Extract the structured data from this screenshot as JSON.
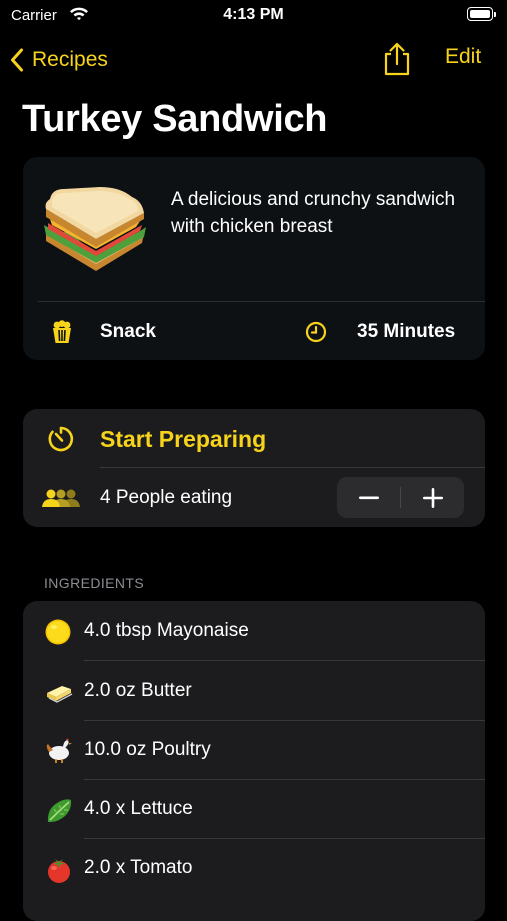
{
  "status_bar": {
    "carrier": "Carrier",
    "time": "4:13 PM"
  },
  "nav": {
    "back_label": "Recipes",
    "edit_label": "Edit"
  },
  "recipe": {
    "title": "Turkey Sandwich",
    "description": "A delicious and crunchy sandwich with chicken breast",
    "category": "Snack",
    "duration": "35 Minutes"
  },
  "preparation": {
    "start_label": "Start Preparing",
    "people_label": "4 People eating"
  },
  "ingredients": {
    "section_title": "INGREDIENTS",
    "items": [
      {
        "text": "4.0 tbsp Mayonaise",
        "icon": "mayonnaise-icon"
      },
      {
        "text": "2.0 oz Butter",
        "icon": "butter-icon"
      },
      {
        "text": "10.0 oz Poultry",
        "icon": "poultry-icon"
      },
      {
        "text": "4.0 x Lettuce",
        "icon": "lettuce-icon"
      },
      {
        "text": "2.0 x Tomato",
        "icon": "tomato-icon"
      }
    ]
  },
  "colors": {
    "accent": "#f7d31b",
    "background": "#000000",
    "card": "#1c1c1e"
  }
}
